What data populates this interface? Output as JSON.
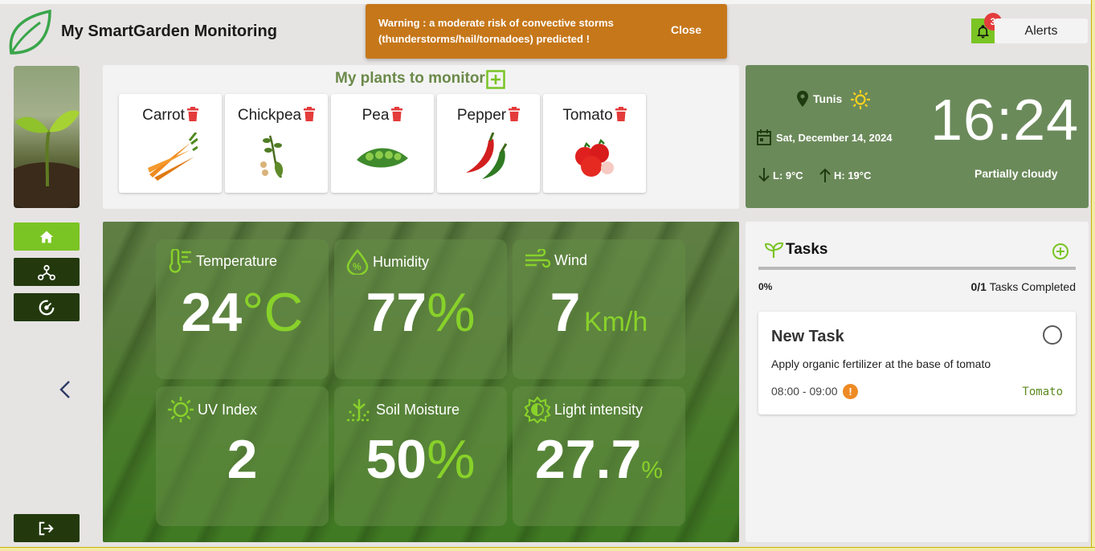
{
  "app": {
    "title": "My SmartGarden Monitoring"
  },
  "warning": {
    "message": "Warning : a moderate risk of convective storms (thunderstorms/hail/tornadoes) predicted !",
    "close_label": "Close",
    "color": "#c6771a"
  },
  "alerts": {
    "label": "Alerts",
    "count": "3"
  },
  "sidebar": {
    "items": [
      {
        "name": "home",
        "icon": "home-icon",
        "active": true
      },
      {
        "name": "network",
        "icon": "network-icon",
        "active": false
      },
      {
        "name": "insights",
        "icon": "gauge-icon",
        "active": false
      }
    ],
    "logout_icon": "logout-icon"
  },
  "plants": {
    "title": "My plants to monitor",
    "items": [
      {
        "name": "Carrot"
      },
      {
        "name": "Chickpea"
      },
      {
        "name": "Pea"
      },
      {
        "name": "Pepper"
      },
      {
        "name": "Tomato"
      }
    ]
  },
  "weather": {
    "city": "Tunis",
    "date": "Sat, December 14, 2024",
    "low": "L: 9°C",
    "high": "H: 19°C",
    "time": "16:24",
    "condition": "Partially cloudy"
  },
  "metrics": {
    "temperature": {
      "label": "Temperature",
      "value": "24",
      "unit": "°C"
    },
    "humidity": {
      "label": "Humidity",
      "value": "77",
      "unit": "%"
    },
    "wind": {
      "label": "Wind",
      "value": "7",
      "unit": "Km/h"
    },
    "uv": {
      "label": "UV Index",
      "value": "2",
      "unit": ""
    },
    "soil": {
      "label": "Soil Moisture",
      "value": "50",
      "unit": "%"
    },
    "light": {
      "label": "Light intensity",
      "value": "27.7",
      "unit": "%"
    }
  },
  "tasks": {
    "title": "Tasks",
    "progress": "0%",
    "completed": "0/1",
    "completed_suffix": "Tasks Completed",
    "items": [
      {
        "title": "New Task",
        "description": "Apply organic fertilizer at the base of tomato",
        "time": "08:00 - 09:00",
        "priority": "!",
        "plant": "Tomato"
      }
    ]
  },
  "colors": {
    "accent": "#7ac424",
    "nav_dark": "#23390d",
    "weather_bg": "#6b8a5a",
    "danger": "#e43b3b"
  }
}
